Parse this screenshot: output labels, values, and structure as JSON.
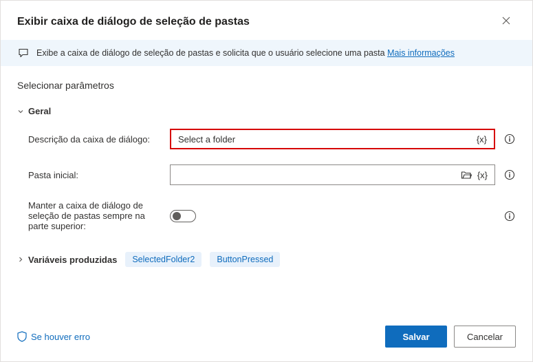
{
  "header": {
    "title": "Exibir caixa de diálogo de seleção de pastas"
  },
  "info": {
    "text": "Exibe a caixa de diálogo de seleção de pastas e solicita que o usuário selecione uma pasta ",
    "link": "Mais informações"
  },
  "section": {
    "title": "Selecionar parâmetros"
  },
  "group_general": "Geral",
  "fields": {
    "description": {
      "label": "Descrição da caixa de diálogo:",
      "value": "Select a folder"
    },
    "initial_folder": {
      "label": "Pasta inicial:",
      "value": ""
    },
    "keep_on_top": {
      "label": "Manter a caixa de diálogo de seleção de pastas sempre na parte superior:"
    }
  },
  "variables": {
    "header": "Variáveis produzidas",
    "chips": [
      "SelectedFolder2",
      "ButtonPressed"
    ]
  },
  "footer": {
    "on_error": "Se houver erro",
    "save": "Salvar",
    "cancel": "Cancelar"
  },
  "tokens": {
    "var_brace": "{x}"
  }
}
